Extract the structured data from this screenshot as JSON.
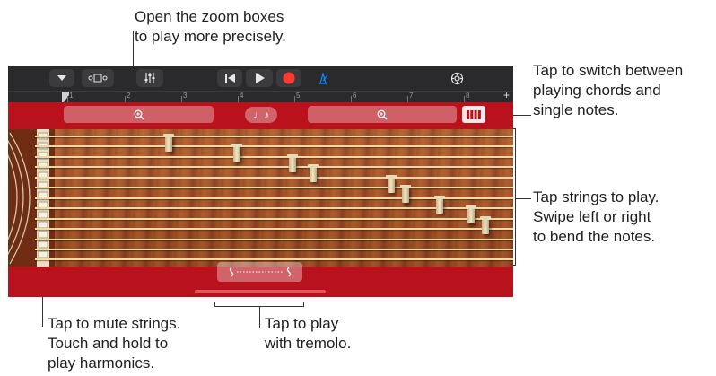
{
  "callouts": {
    "zoom": "Open the zoom boxes\nto play more precisely.",
    "chords": "Tap to switch between\nplaying chords and\nsingle notes.",
    "strings": "Tap strings to play.\nSwipe left or right\nto bend the notes.",
    "mute": "Tap to mute strings.\nTouch and hold to\nplay harmonics.",
    "tremolo": "Tap to play\nwith tremolo."
  },
  "toolbar": {
    "icons": [
      "chevron-down-icon",
      "browser-view-icon",
      "mixer-icon",
      "rewind-icon",
      "play-icon",
      "record-icon",
      "metronome-icon",
      "settings-icon"
    ],
    "record_color": "#ff3b30",
    "metronome_color": "#0a84ff"
  },
  "ruler": {
    "marks": [
      "1",
      "2",
      "3",
      "4",
      "5",
      "6",
      "7",
      "8"
    ],
    "add_label": "+"
  },
  "controls": {
    "zoom_icon": "zoom-in-icon",
    "note_toggle_glyph": "♩♪",
    "chord_icon": "chord-strips-icon",
    "tremolo_icon": "tremolo-icon"
  },
  "colors": {
    "accent_red": "#b8121d",
    "string": "#f3d8a2",
    "wood": "#a6532a"
  }
}
